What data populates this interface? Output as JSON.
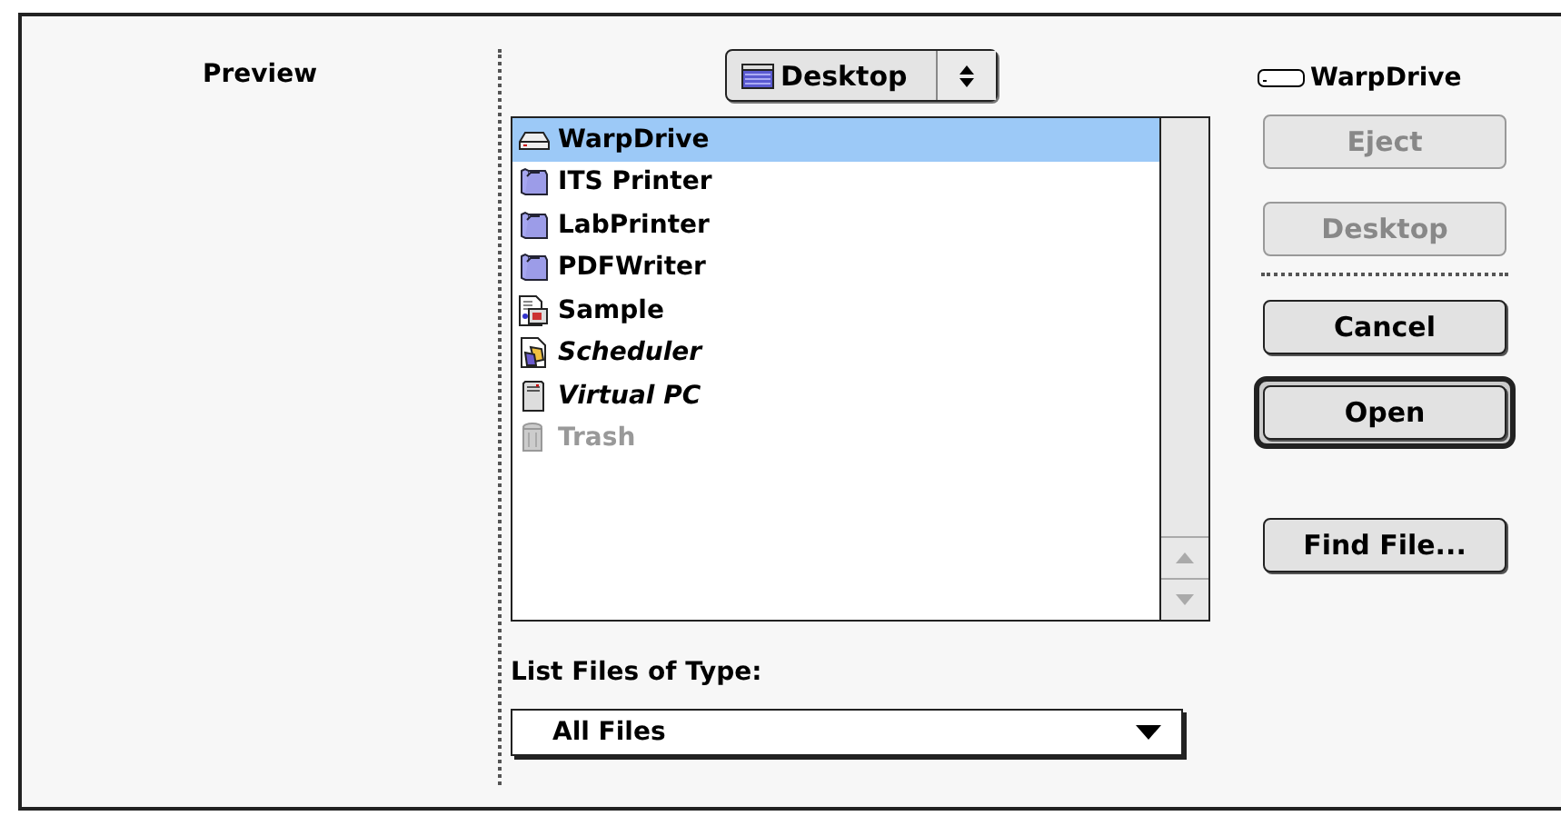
{
  "preview": {
    "title": "Preview"
  },
  "location_popup": {
    "label": "Desktop"
  },
  "files": [
    {
      "name": "WarpDrive",
      "kind": "disk",
      "selected": true,
      "alias": false,
      "disabled": false
    },
    {
      "name": "ITS Printer",
      "kind": "folder",
      "selected": false,
      "alias": false,
      "disabled": false
    },
    {
      "name": "LabPrinter",
      "kind": "folder",
      "selected": false,
      "alias": false,
      "disabled": false
    },
    {
      "name": "PDFWriter",
      "kind": "folder",
      "selected": false,
      "alias": false,
      "disabled": false
    },
    {
      "name": "Sample",
      "kind": "document",
      "selected": false,
      "alias": false,
      "disabled": false
    },
    {
      "name": "Scheduler",
      "kind": "application",
      "selected": false,
      "alias": true,
      "disabled": false
    },
    {
      "name": "Virtual PC",
      "kind": "computer",
      "selected": false,
      "alias": true,
      "disabled": false
    },
    {
      "name": "Trash",
      "kind": "trash",
      "selected": false,
      "alias": false,
      "disabled": true
    }
  ],
  "file_type": {
    "label": "List Files of Type:",
    "value": "All Files"
  },
  "volume": {
    "name": "WarpDrive"
  },
  "button_groups": [
    {
      "kind": "navigation",
      "buttons": [
        {
          "label": "Eject",
          "disabled": true,
          "default": false
        },
        {
          "label": "Desktop",
          "disabled": true,
          "default": false
        }
      ]
    },
    {
      "kind": "actions",
      "buttons": [
        {
          "label": "Cancel",
          "disabled": false,
          "default": false
        },
        {
          "label": "Open",
          "disabled": false,
          "default": true
        }
      ]
    },
    {
      "kind": "extra",
      "buttons": [
        {
          "label": "Find File...",
          "disabled": false,
          "default": false
        }
      ]
    }
  ]
}
